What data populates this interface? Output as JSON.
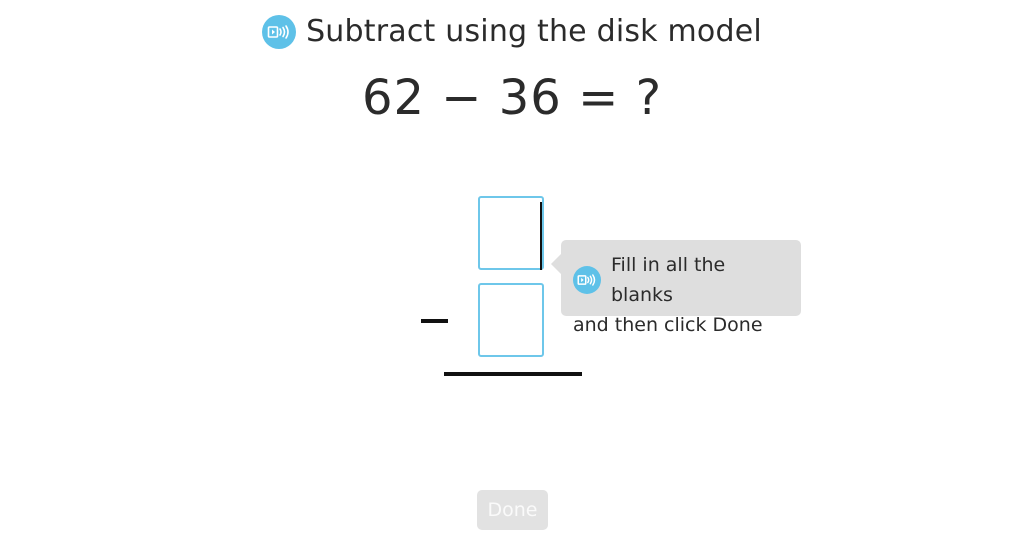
{
  "header": {
    "title": "Subtract using the disk model",
    "audio_icon": "speaker-icon"
  },
  "equation": {
    "text": "62 − 36 = ?"
  },
  "problem": {
    "top_value": "",
    "bottom_value": "",
    "operator": "−"
  },
  "tooltip": {
    "audio_icon": "speaker-icon",
    "line1": "Fill in all the blanks",
    "line2": "and then click Done"
  },
  "buttons": {
    "done_label": "Done"
  },
  "colors": {
    "accent": "#5ec1e8",
    "box_border": "#6ec7ea",
    "tooltip_bg": "#dedede",
    "button_disabled_bg": "#e2e2e2"
  }
}
